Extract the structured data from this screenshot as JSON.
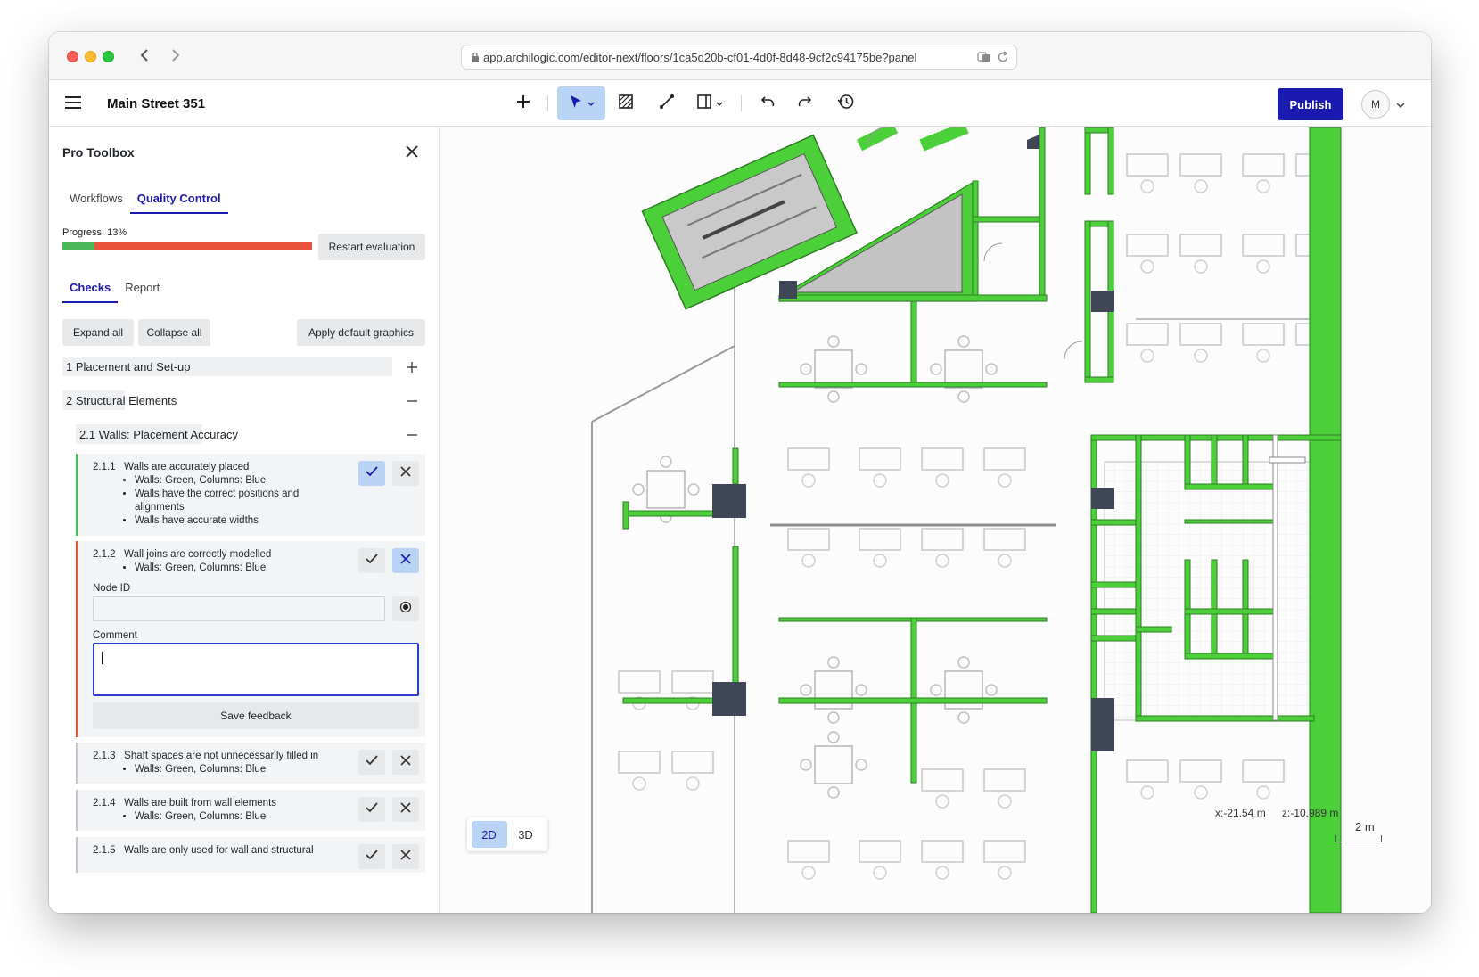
{
  "browser": {
    "url": "app.archilogic.com/editor-next/floors/1ca5d20b-cf01-4d0f-8d48-9cf2c94175be?panel"
  },
  "header": {
    "project_title": "Main Street 351",
    "publish_label": "Publish",
    "avatar_initial": "M"
  },
  "sidebar": {
    "title": "Pro Toolbox",
    "tabs": [
      {
        "label": "Workflows",
        "active": false
      },
      {
        "label": "Quality Control",
        "active": true
      }
    ],
    "progress": {
      "label": "Progress: 13%",
      "percent": 13
    },
    "restart_label": "Restart evaluation",
    "subtabs": [
      {
        "label": "Checks",
        "active": true
      },
      {
        "label": "Report",
        "active": false
      }
    ],
    "expand_all_label": "Expand all",
    "collapse_all_label": "Collapse all",
    "apply_default_label": "Apply default graphics",
    "sections": [
      {
        "label": "1 Placement and Set-up",
        "expanded": false
      },
      {
        "label": "2 Structural Elements",
        "expanded": true
      }
    ],
    "subsection": {
      "label": "2.1 Walls: Placement Accuracy",
      "expanded": true
    },
    "checks": [
      {
        "id": "2.1.1",
        "title": "Walls are accurately placed",
        "bullets": [
          "Walls: Green, Columns: Blue",
          "Walls have the correct positions and alignments",
          "Walls have accurate widths"
        ],
        "status": "pass",
        "status_color": "#4cb85a"
      },
      {
        "id": "2.1.2",
        "title": "Wall joins are correctly modelled",
        "bullets": [
          "Walls: Green, Columns: Blue"
        ],
        "status": "fail",
        "status_color": "#e9523b",
        "node_id_label": "Node ID",
        "node_id_value": "",
        "comment_label": "Comment",
        "comment_value": "",
        "save_label": "Save feedback"
      },
      {
        "id": "2.1.3",
        "title": "Shaft spaces are not unnecessarily filled in",
        "bullets": [
          "Walls: Green, Columns: Blue"
        ],
        "status": "none",
        "status_color": "#c4c8cc"
      },
      {
        "id": "2.1.4",
        "title": "Walls are built from wall elements",
        "bullets": [
          "Walls: Green, Columns: Blue"
        ],
        "status": "none",
        "status_color": "#c4c8cc"
      },
      {
        "id": "2.1.5",
        "title": "Walls are only used for wall and structural",
        "bullets": [],
        "status": "none",
        "status_color": "#c4c8cc"
      }
    ]
  },
  "canvas": {
    "view_modes": [
      {
        "label": "2D",
        "active": true
      },
      {
        "label": "3D",
        "active": false
      }
    ],
    "coord_x": "x:-21.54 m",
    "coord_z": "z:-10.989 m",
    "scale_label": "2 m"
  },
  "colors": {
    "accent": "#1a1ab0",
    "wall_green": "#4cd03a",
    "column_blue": "#3f4756",
    "fail_red": "#e9523b",
    "pass_green": "#4cb85a"
  },
  "icons": {
    "toolbar": [
      "plus-icon",
      "pointer-icon",
      "hatch-icon",
      "line-icon",
      "door-icon",
      "undo-icon",
      "redo-icon",
      "history-icon"
    ]
  }
}
